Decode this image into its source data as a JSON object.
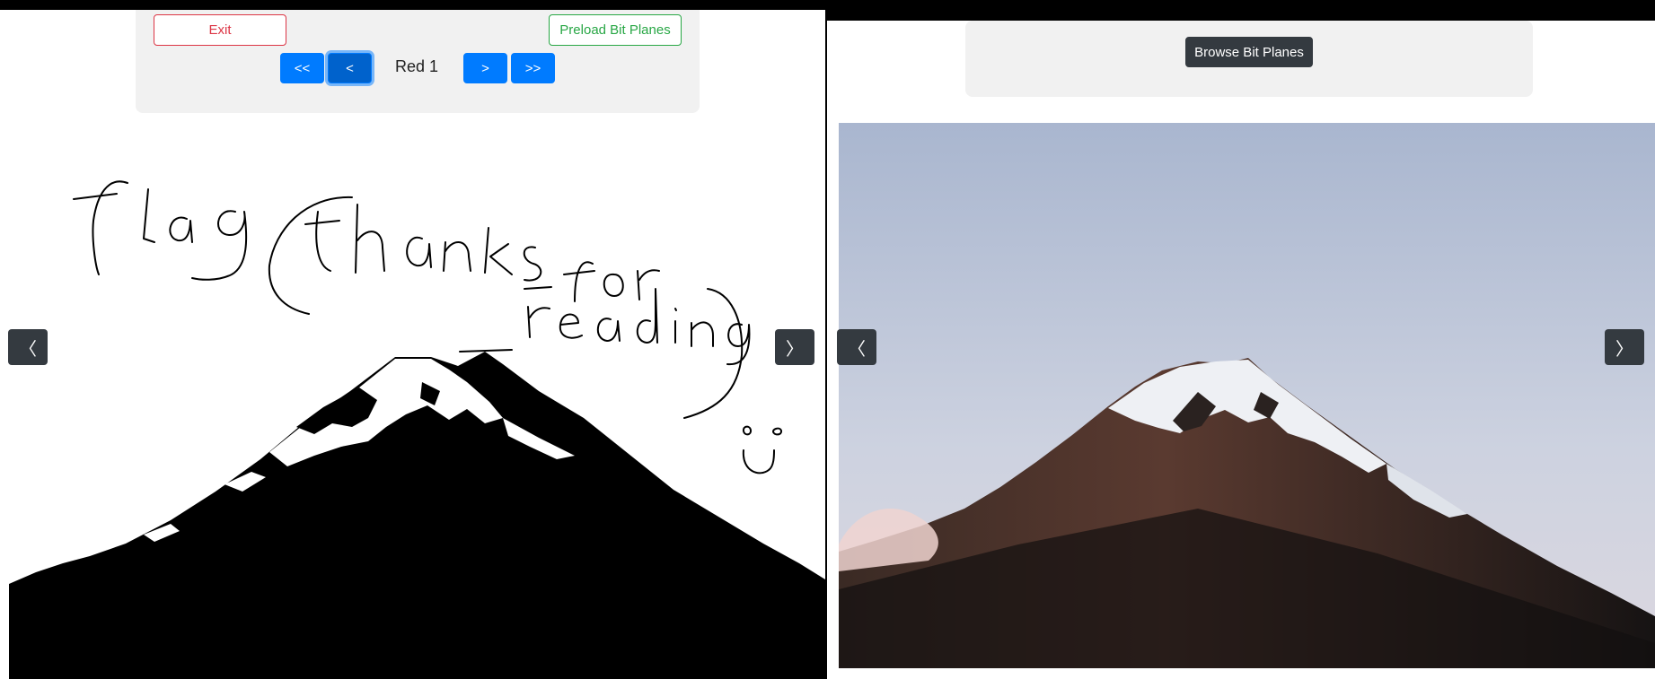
{
  "left": {
    "exit_label": "Exit",
    "preload_label": "Preload Bit Planes",
    "first_label": "<<",
    "prev_label": "<",
    "plane_label": "Red 1",
    "next_label": ">",
    "last_label": ">>",
    "prev_arrow": "〈",
    "next_arrow": "〉",
    "image_text": "flag{thanks_for_reading}"
  },
  "right": {
    "browse_label": "Browse Bit Planes",
    "prev_arrow": "〈",
    "next_arrow": "〉"
  },
  "colors": {
    "primary": "#007bff",
    "danger": "#dc3545",
    "success": "#28a745",
    "dark": "#343a40"
  }
}
